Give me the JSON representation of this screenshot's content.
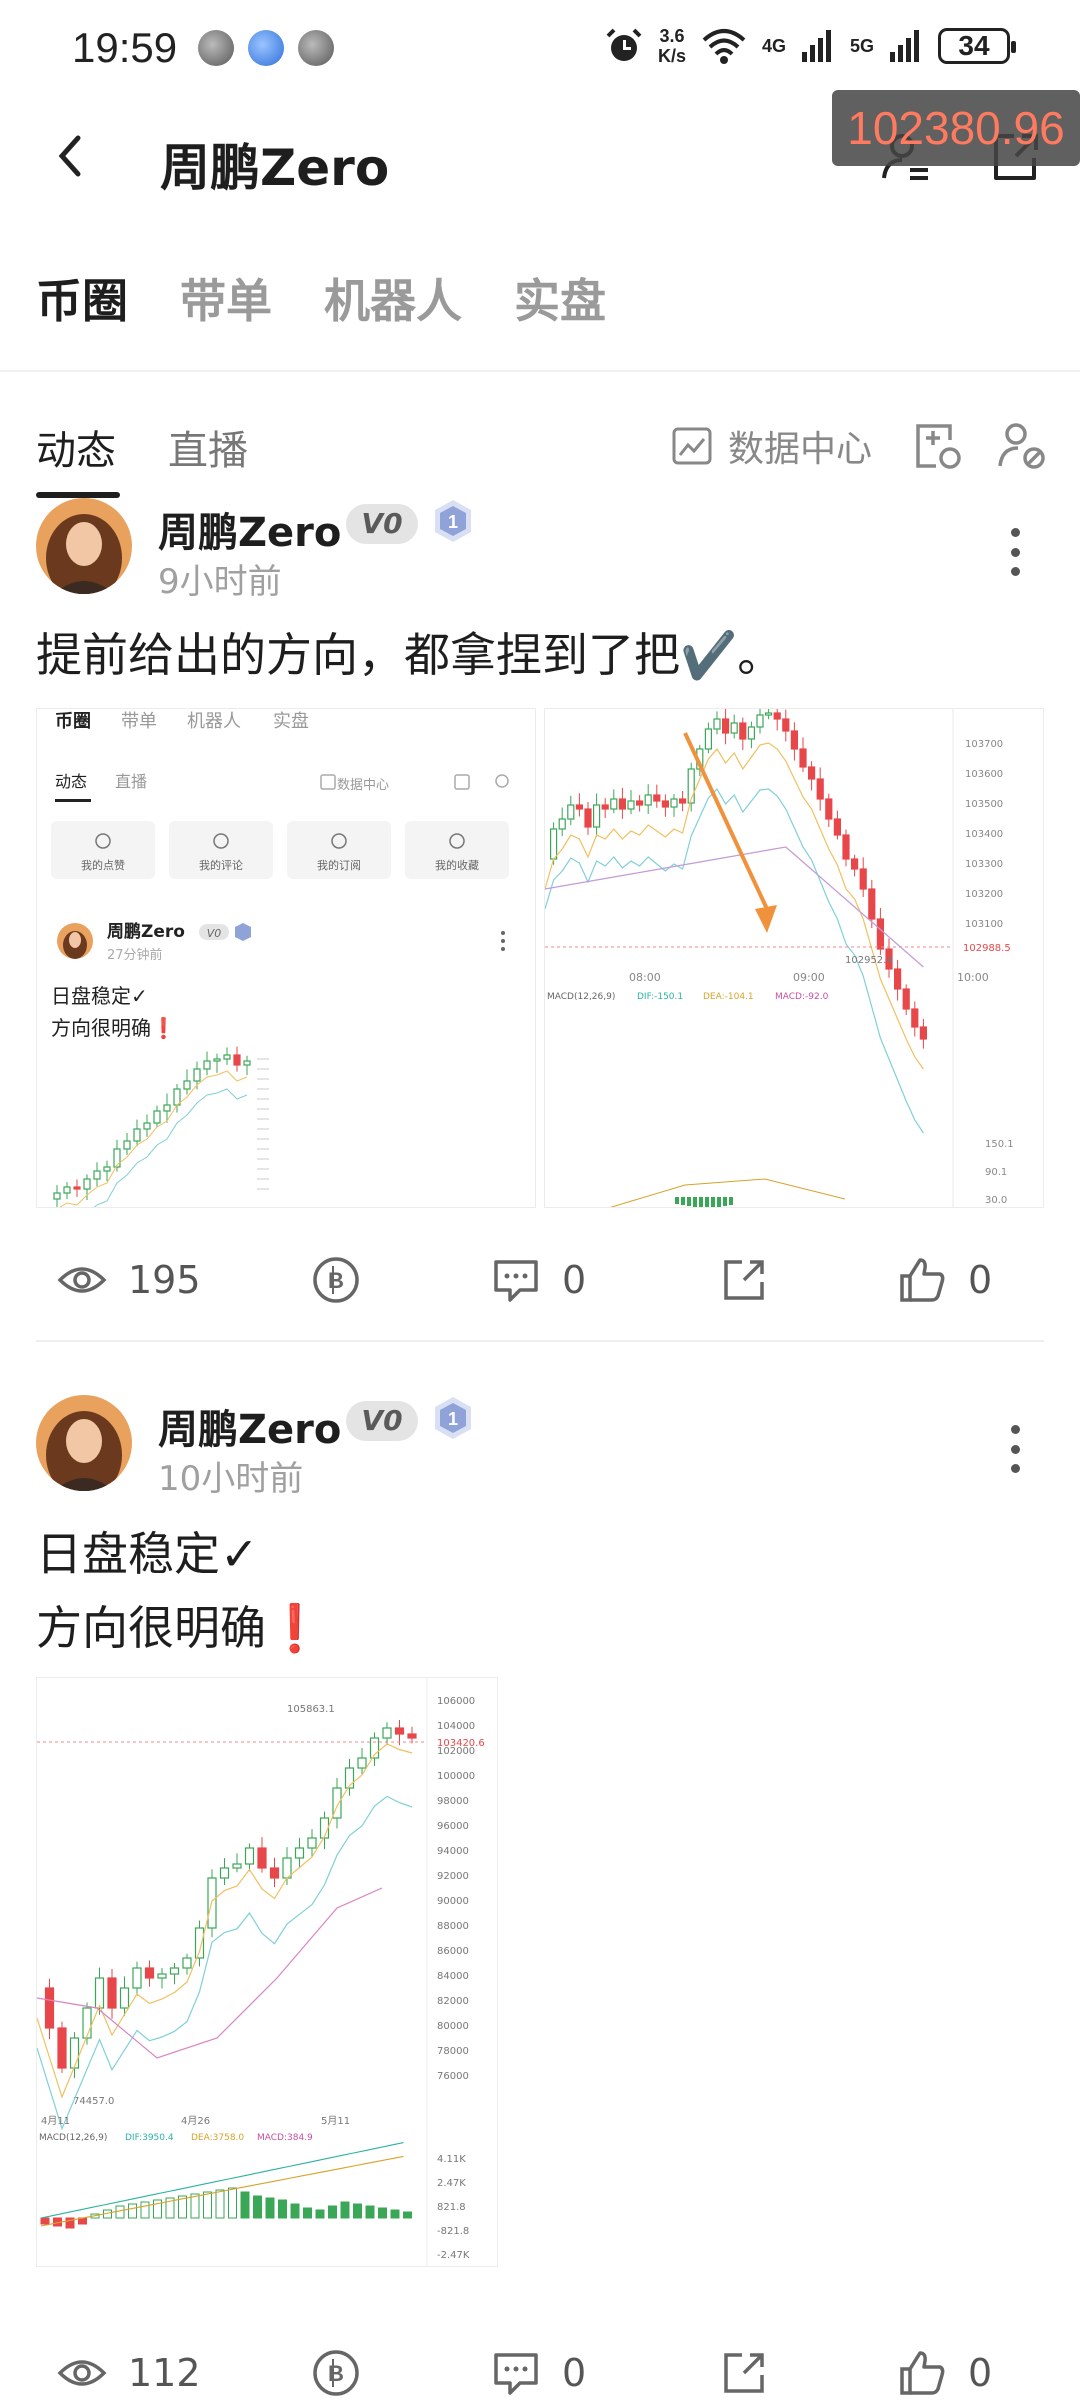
{
  "status_bar": {
    "time": "19:59",
    "net_speed_value": "3.6",
    "net_speed_unit": "K/s",
    "network_1": "4G",
    "network_2": "5G",
    "battery": "34"
  },
  "header": {
    "title": "周鹏Zero",
    "price_overlay": "102380.96"
  },
  "top_tabs": [
    "币圈",
    "带单",
    "机器人",
    "实盘"
  ],
  "sub_tabs": [
    "动态",
    "直播"
  ],
  "data_center_label": "数据中心",
  "posts": [
    {
      "author": "周鹏Zero",
      "badge": "V0",
      "level": "1",
      "time": "9小时前",
      "text": "提前给出的方向，都拿捏到了把✔️。",
      "views": "195",
      "comments": "0",
      "likes": "0",
      "image_left": {
        "tabs": [
          "币圈",
          "带单",
          "机器人",
          "实盘"
        ],
        "sub_tabs": [
          "动态",
          "直播"
        ],
        "data_center": "数据中心",
        "actions": [
          "我的点赞",
          "我的评论",
          "我的订阅",
          "我的收藏"
        ],
        "author": "周鹏Zero",
        "badge": "V0",
        "time": "27分钟前",
        "text": "日盘稳定✓\n方向很明确❗"
      },
      "image_right": {
        "price_ticks": [
          "103700",
          "103600",
          "103500",
          "103400",
          "103300",
          "103200",
          "103100"
        ],
        "current_price": "102988.5",
        "low_label": "102952.4",
        "time_ticks": [
          "08:00",
          "09:00",
          "10:00"
        ],
        "macd_label": "MACD(12,26,9)",
        "dif": "DIF:-150.1",
        "dea": "DEA:-104.1",
        "macd": "MACD:-92.0",
        "macd_ticks": [
          "150.1",
          "90.1",
          "30.0"
        ]
      }
    },
    {
      "author": "周鹏Zero",
      "badge": "V0",
      "level": "1",
      "time": "10小时前",
      "text": "日盘稳定✓\n方向很明确❗",
      "views": "112",
      "comments": "0",
      "likes": "0",
      "image": {
        "price_ticks": [
          "106000",
          "104000",
          "102000",
          "100000",
          "98000",
          "96000",
          "94000",
          "92000",
          "90000",
          "88000",
          "86000",
          "84000",
          "82000",
          "80000",
          "78000",
          "76000"
        ],
        "high_label": "105863.1",
        "current_price": "103420.6",
        "low_label": "74457.0",
        "date_ticks": [
          "4月11",
          "4月26",
          "5月11"
        ],
        "macd_label": "MACD(12,26,9)",
        "dif": "DIF:3950.4",
        "dea": "DEA:3758.0",
        "macd": "MACD:384.9",
        "macd_ticks": [
          "4.11K",
          "2.47K",
          "821.8",
          "-821.8",
          "-2.47K"
        ]
      }
    }
  ],
  "colors": {
    "up": "#3aa757",
    "down": "#e8474a",
    "accent_arrow": "#f0923c"
  }
}
